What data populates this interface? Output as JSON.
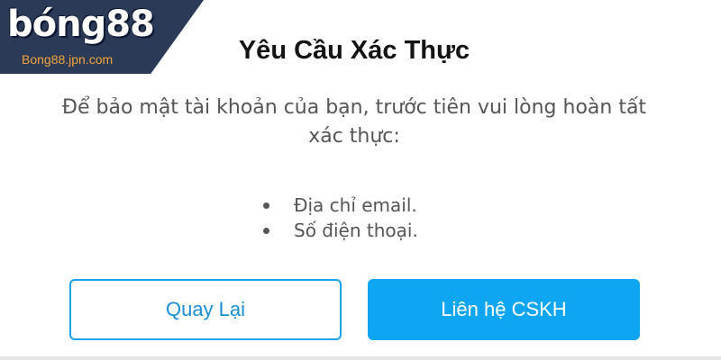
{
  "logo": {
    "text": "bóng88",
    "subtext": "Bong88.jpn.com"
  },
  "dialog": {
    "title": "Yêu Cầu Xác Thực",
    "description": "Để bảo mật tài khoản của bạn, trước tiên vui lòng hoàn tất xác thực:",
    "requirements": [
      "Địa chỉ email.",
      "Số điện thoại."
    ],
    "buttons": {
      "back_label": "Quay Lại",
      "contact_label": "Liên hệ CSKH"
    }
  },
  "colors": {
    "accent": "#0ea5f3",
    "title": "#141414",
    "body_text": "#555555",
    "logo_bg": "#2b3a57",
    "logo_sub": "#f3a43b"
  }
}
